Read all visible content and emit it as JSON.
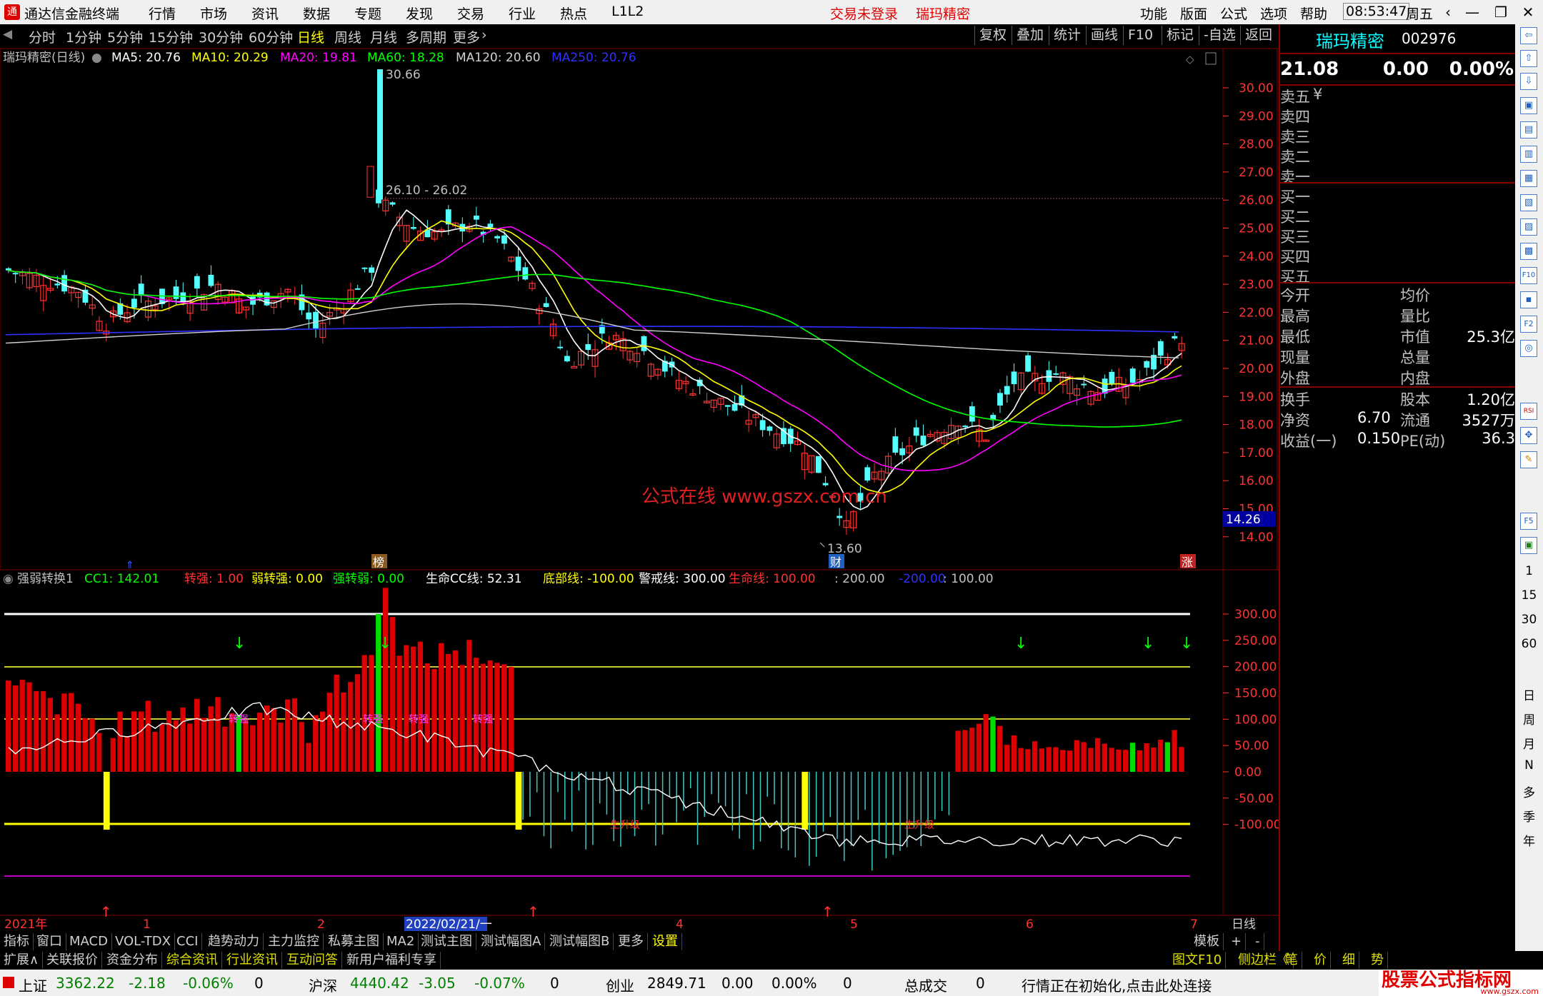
{
  "titlebar": {
    "app_name": "通达信金融终端",
    "menus": [
      "行情",
      "市场",
      "资讯",
      "数据",
      "专题",
      "发现",
      "交易",
      "行业",
      "热点",
      "L1L2"
    ],
    "trade_status": "交易未登录",
    "stock_link": "瑞玛精密",
    "right_menus": [
      "功能",
      "版面",
      "公式",
      "选项",
      "帮助"
    ],
    "time": "08:53:47",
    "weekday": "周五"
  },
  "toolbar": {
    "periods": [
      "分时",
      "1分钟",
      "5分钟",
      "15分钟",
      "30分钟",
      "60分钟",
      "日线",
      "周线",
      "月线",
      "多周期",
      "更多"
    ],
    "active_period": "日线",
    "right_buttons": [
      "复权",
      "叠加",
      "统计",
      "画线",
      "F10",
      "标记",
      "-自选",
      "返回"
    ]
  },
  "kline": {
    "header": {
      "name": "瑞玛精密(日线)",
      "ma5": "MA5: 20.76",
      "ma10": "MA10: 20.29",
      "ma20": "MA20: 19.81",
      "ma60": "MA60: 18.28",
      "ma120": "MA120: 20.60",
      "ma250": "MA250: 20.76"
    },
    "ticks": [
      "30.00",
      "29.00",
      "28.00",
      "27.00",
      "26.00",
      "25.00",
      "24.00",
      "23.00",
      "22.00",
      "21.00",
      "20.00",
      "19.00",
      "18.00",
      "17.00",
      "16.00",
      "15.00",
      "14.00"
    ],
    "price_tag": "14.26",
    "annot_high": "30.66",
    "annot_range": "26.10 - 26.02",
    "annot_low": "13.60",
    "watermark": "公式在线 www.gszx.com.cn",
    "marker_bang": "榜",
    "marker_cai": "财",
    "marker_zhang": "涨"
  },
  "indicator": {
    "header": {
      "name": "强弱转换1",
      "cc1": "CC1: 142.01",
      "zhuanqiang": "转强: 1.00",
      "ruozhuanqiang": "弱转强: 0.00",
      "qiangzhuanruo": "强转弱: 0.00",
      "shengming_cc": "生命CC线: 52.31",
      "dibu": "底部线: -100.00",
      "jingjie": "警戒线: 300.00",
      "shengming_line": "生命线: 100.00",
      "v200": ": 200.00",
      "vneg200": "-200.00",
      "v100": ": 100.00"
    },
    "ticks": [
      "300.00",
      "250.00",
      "200.00",
      "150.00",
      "100.00",
      "50.00",
      "0.00",
      "-50.00",
      "-100.00"
    ],
    "label_strong": "转强",
    "label_up": "生升级"
  },
  "xaxis": {
    "labels": [
      "2021年",
      "1",
      "2",
      "3",
      "4",
      "5",
      "6",
      "7"
    ],
    "cursor_date": "2022/02/21/一",
    "period": "日线"
  },
  "tabs1": [
    "指标",
    "窗口",
    "MACD",
    "VOL-TDX",
    "CCI",
    "趋势动力",
    "主力监控",
    "私募主图",
    "MA2",
    "测试主图",
    "测试幅图A",
    "测试幅图B",
    "更多",
    "设置"
  ],
  "tabs1_right": [
    "模板",
    "+",
    "-"
  ],
  "tabs2": [
    "扩展∧",
    "关联报价",
    "资金分布",
    "综合资讯",
    "行业资讯",
    "互动问答",
    "新用户福利专享"
  ],
  "tabs2_right": [
    "图文F10",
    "侧边栏《",
    "笔",
    "价",
    "细",
    "势"
  ],
  "quote": {
    "name": "瑞玛精密",
    "code": "002976",
    "price": "21.08",
    "change": "0.00",
    "pct": "0.00%",
    "sell": [
      "卖五",
      "卖四",
      "卖三",
      "卖二",
      "卖一"
    ],
    "buy": [
      "买一",
      "买二",
      "买三",
      "买四",
      "买五"
    ],
    "currency": "¥",
    "stats": [
      [
        "今开",
        "",
        "均价",
        ""
      ],
      [
        "最高",
        "",
        "量比",
        ""
      ],
      [
        "最低",
        "",
        "市值",
        "25.3亿"
      ],
      [
        "现量",
        "",
        "总量",
        ""
      ],
      [
        "外盘",
        "",
        "内盘",
        ""
      ],
      [
        "换手",
        "",
        "股本",
        "1.20亿"
      ],
      [
        "净资",
        "6.70",
        "流通",
        "3527万"
      ],
      [
        "收益(一)",
        "0.150",
        "PE(动)",
        "36.3"
      ]
    ]
  },
  "status": {
    "sh_name": "上证",
    "sh_val": "3362.22",
    "sh_chg": "-2.18",
    "sh_pct": "-0.06%",
    "sh_vol": "0",
    "hs_name": "沪深",
    "hs_val": "4440.42",
    "hs_chg": "-3.05",
    "hs_pct": "-0.07%",
    "hs_vol": "0",
    "cy_name": "创业",
    "cy_val": "2849.71",
    "cy_chg": "0.00",
    "cy_pct": "0.00%",
    "cy_vol": "0",
    "total_label": "总成交",
    "total_val": "0",
    "msg": "行情正在初始化,点击此处连接"
  },
  "right_icons": [
    "⇦",
    "⇧",
    "⇩",
    "▣",
    "▤",
    "▥",
    "▦",
    "▧",
    "▨",
    "▩",
    "F10",
    "▪",
    "F2",
    "◎",
    "RSI",
    "✥",
    "✎",
    "F5",
    "▣"
  ],
  "right_texts": [
    "1",
    "15",
    "30",
    "60",
    "日",
    "周",
    "月",
    "N",
    "多",
    "季",
    "年"
  ],
  "logo": {
    "text": "股票公式指标网",
    "url": "www.gszx.com"
  },
  "colors": {
    "up": "#ff3232",
    "down": "#54ffff",
    "ma5": "#ffffff",
    "ma10": "#ffff00",
    "ma20": "#ff00ff",
    "ma60": "#00ff00",
    "ma120": "#d0d0d0",
    "ma250": "#3030ff"
  }
}
